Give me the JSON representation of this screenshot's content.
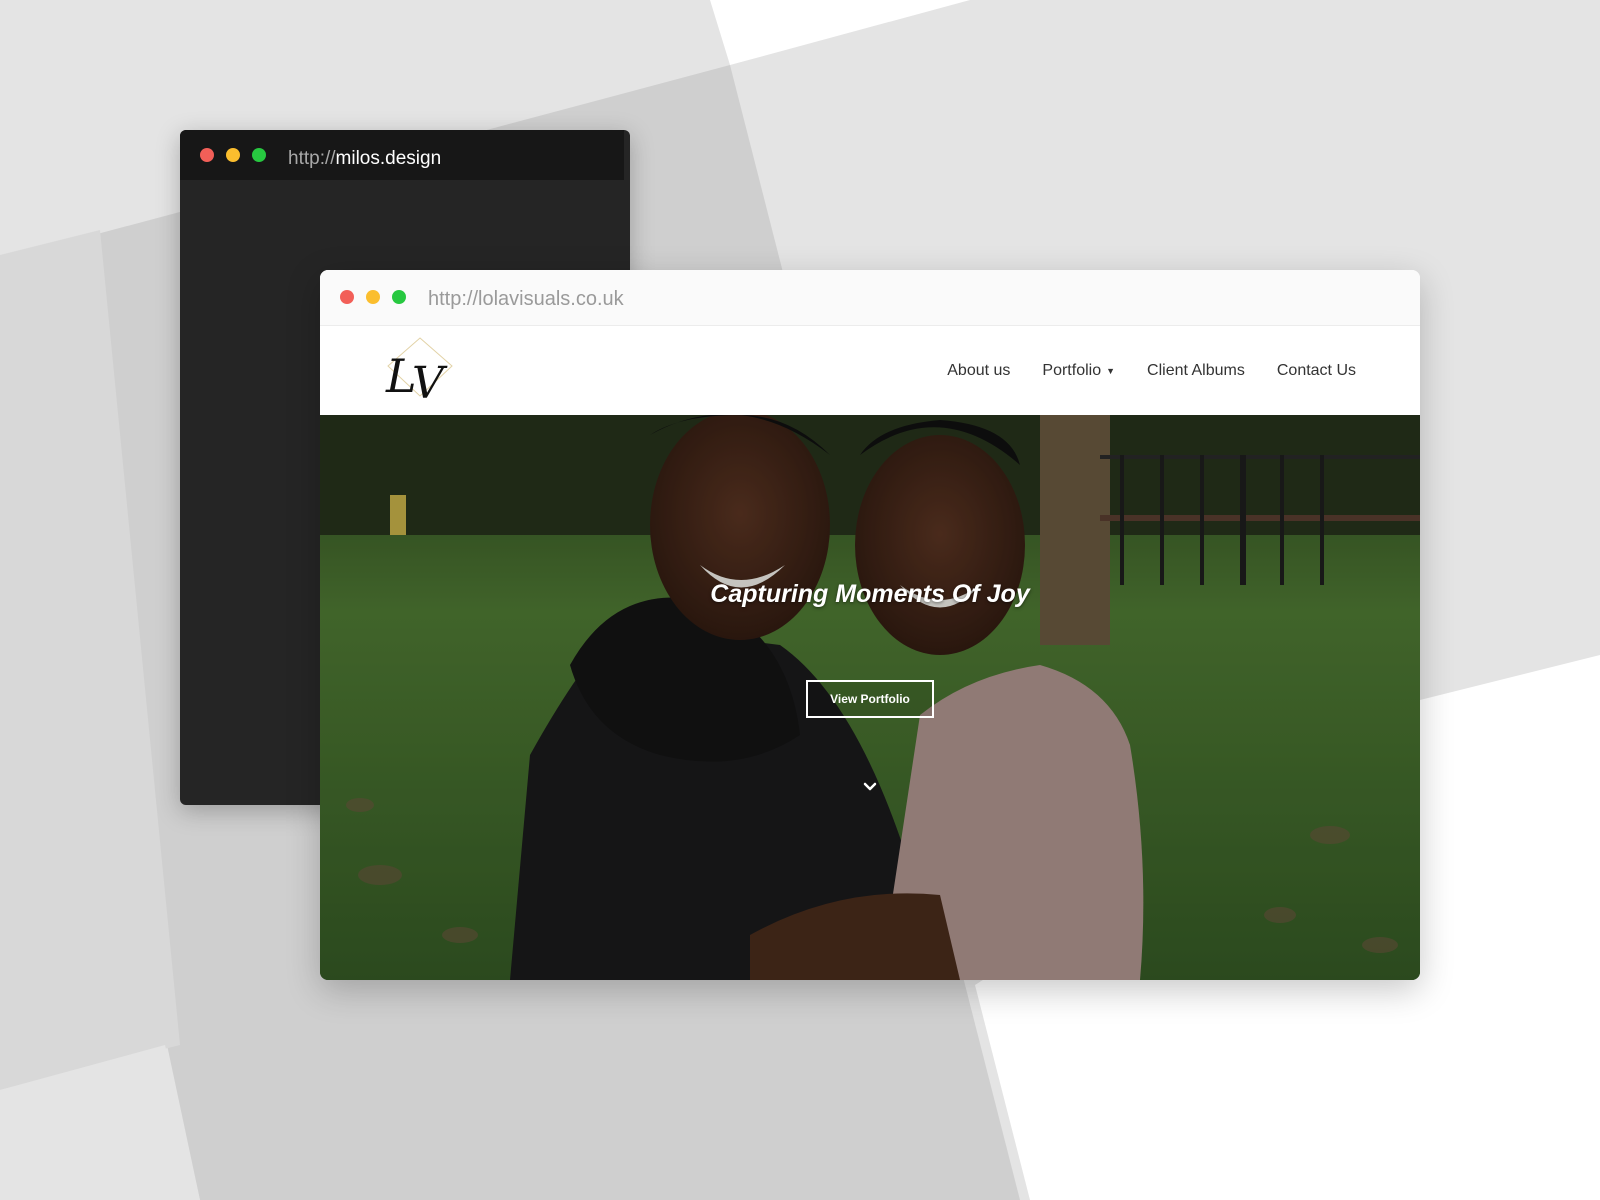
{
  "back_window": {
    "url_scheme": "http://",
    "url_host": "milos.design",
    "controls": [
      "close",
      "minimize",
      "maximize"
    ]
  },
  "front_window": {
    "url": "http://lolavisuals.co.uk",
    "controls": [
      "close",
      "minimize",
      "maximize"
    ]
  },
  "site": {
    "logo_text": "LV",
    "nav": [
      {
        "label": "About us"
      },
      {
        "label": "Portfolio",
        "has_dropdown": true
      },
      {
        "label": "Client Albums"
      },
      {
        "label": "Contact Us"
      }
    ],
    "hero": {
      "title": "Capturing Moments Of Joy",
      "button_label": "View Portfolio",
      "scroll_icon": "chevron-down-icon"
    }
  },
  "colors": {
    "dot_red": "#f25f58",
    "dot_yellow": "#fbbe2e",
    "dot_green": "#27c840",
    "dark_window": "#252525",
    "dark_titlebar": "#171717"
  }
}
